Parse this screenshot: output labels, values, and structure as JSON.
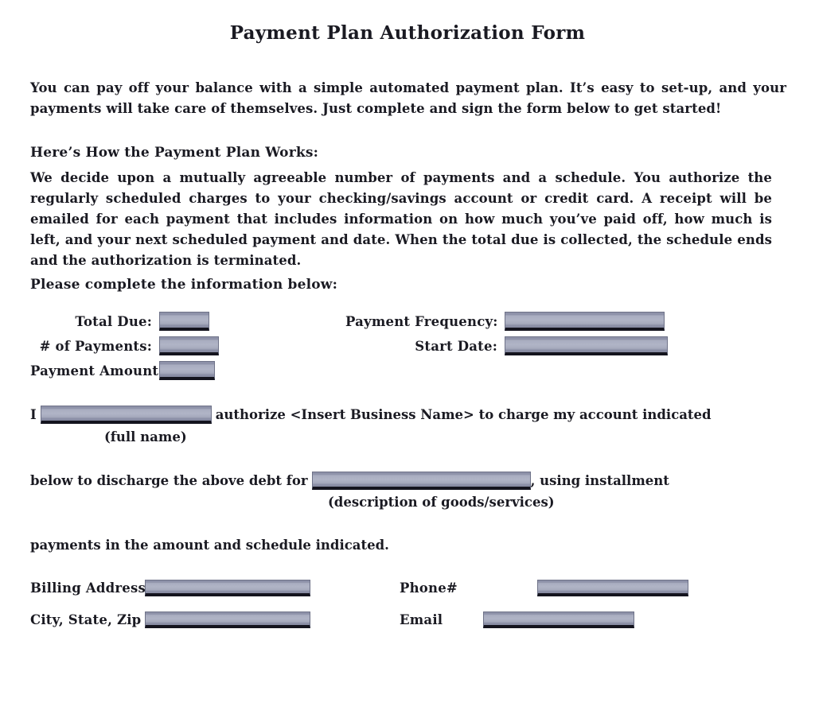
{
  "document": {
    "title": "Payment Plan Authorization Form",
    "intro_paragraph": "You can pay off your balance with a simple automated payment plan.  It’s easy to set-up, and your payments will take care of themselves.  Just complete and sign the form below to get started!",
    "how_heading": "Here’s How  the Payment Plan Works:",
    "how_paragraph": "We  decide  upon  a  mutually  agreeable  number  of  payments  and  a  schedule.   You  authorize  the  regularly  scheduled  charges  to  your  checking/savings  account  or  credit  card.   A  receipt  will  be  emailed  for  each  payment  that  includes  information  on  how  much  you’ve  paid  off,  how  much  is  left,  and  your  next  scheduled  payment  and  date.   When  the  total  due  is  collected,  the  schedule  ends  and  the  authorization  is  terminated.",
    "complete_heading": "Please complete the information  below:"
  },
  "form": {
    "fields": [
      {
        "label": "Total Due:",
        "value": ""
      },
      {
        "label": "# of Payments:",
        "value": ""
      },
      {
        "label": "Payment Amount:",
        "value": ""
      },
      {
        "label": "Payment  Frequency:",
        "value": ""
      },
      {
        "label": "Start Date:",
        "value": ""
      }
    ]
  },
  "authorization": {
    "prefix": "I",
    "name_value": "",
    "middle": "authorize <Insert  Business Name> to charge  my account indicated",
    "name_note": "(full name)",
    "discharge_prefix": "below to discharge  the above debt for",
    "description_value": "",
    "discharge_suffix": ", using installment",
    "description_note": "(description of goods/services)",
    "closing": "payments in the amount and schedule indicated."
  },
  "contact": {
    "fields": [
      {
        "label": "Billing Address",
        "value": ""
      },
      {
        "label": "City, State,  Zip",
        "value": ""
      },
      {
        "label": "Phone#",
        "value": ""
      },
      {
        "label": "Email",
        "value": ""
      }
    ]
  },
  "colors": {
    "field_fill": "#a9adc0",
    "field_shadow": "#14141e",
    "text": "#1a1a22",
    "page_background": "#ffffff"
  }
}
